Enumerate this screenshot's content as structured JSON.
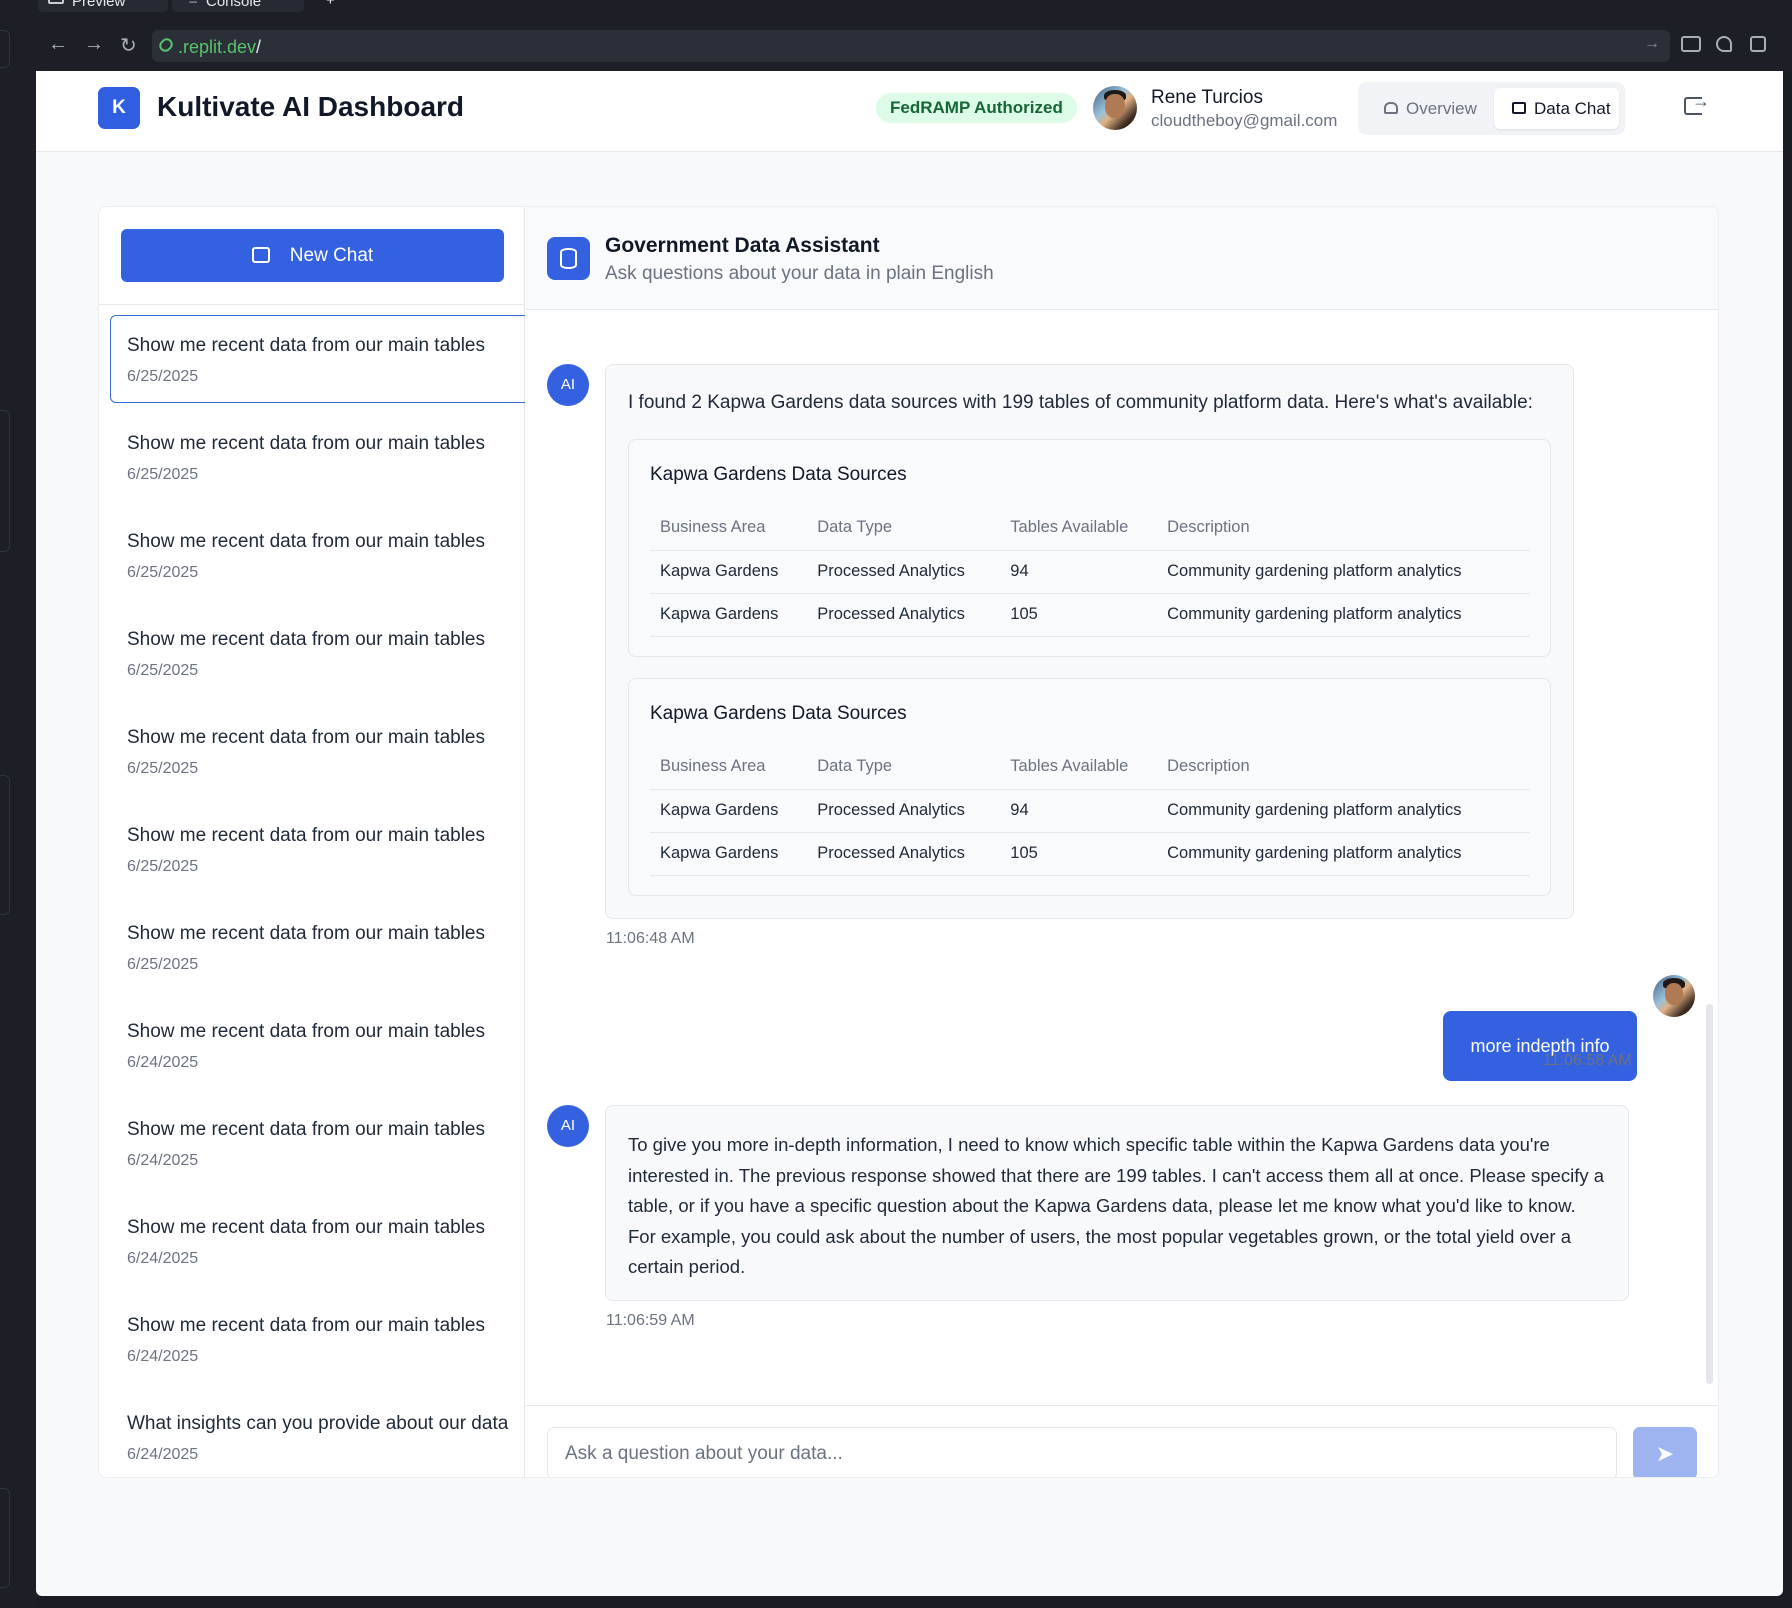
{
  "ide": {
    "tabs": [
      {
        "label": "Preview"
      },
      {
        "label": "Console"
      }
    ],
    "new_tab": "+",
    "url_host": ".replit.dev",
    "url_path": "/"
  },
  "header": {
    "logo_letter": "K",
    "title": "Kultivate AI Dashboard",
    "badge": "FedRAMP Authorized",
    "user_name": "Rene Turcios",
    "user_email": "cloudtheboy@gmail.com",
    "nav": [
      {
        "label": "Overview",
        "active": false
      },
      {
        "label": "Data Chat",
        "active": true
      }
    ]
  },
  "sidebar": {
    "new_chat_label": "New Chat",
    "history": [
      {
        "title": "Show me recent data from our main tables",
        "date": "6/25/2025"
      },
      {
        "title": "Show me recent data from our main tables",
        "date": "6/25/2025"
      },
      {
        "title": "Show me recent data from our main tables",
        "date": "6/25/2025"
      },
      {
        "title": "Show me recent data from our main tables",
        "date": "6/25/2025"
      },
      {
        "title": "Show me recent data from our main tables",
        "date": "6/25/2025"
      },
      {
        "title": "Show me recent data from our main tables",
        "date": "6/25/2025"
      },
      {
        "title": "Show me recent data from our main tables",
        "date": "6/25/2025"
      },
      {
        "title": "Show me recent data from our main tables",
        "date": "6/24/2025"
      },
      {
        "title": "Show me recent data from our main tables",
        "date": "6/24/2025"
      },
      {
        "title": "Show me recent data from our main tables",
        "date": "6/24/2025"
      },
      {
        "title": "Show me recent data from our main tables",
        "date": "6/24/2025"
      },
      {
        "title": "What insights can you provide about our data",
        "date": "6/24/2025"
      }
    ]
  },
  "chat": {
    "title": "Government Data Assistant",
    "subtitle": "Ask questions about your data in plain English",
    "ai_label": "AI",
    "messages": [
      {
        "text": "I found 2 Kapwa Gardens data sources with 199 tables of community platform data. Here's what's available:",
        "time": "11:06:48 AM",
        "tables": [
          {
            "title": "Kapwa Gardens Data Sources",
            "headers": [
              "Business Area",
              "Data Type",
              "Tables Available",
              "Description"
            ],
            "rows": [
              [
                "Kapwa Gardens",
                "Processed Analytics",
                "94",
                "Community gardening platform analytics"
              ],
              [
                "Kapwa Gardens",
                "Processed Analytics",
                "105",
                "Community gardening platform analytics"
              ]
            ]
          },
          {
            "title": "Kapwa Gardens Data Sources",
            "headers": [
              "Business Area",
              "Data Type",
              "Tables Available",
              "Description"
            ],
            "rows": [
              [
                "Kapwa Gardens",
                "Processed Analytics",
                "94",
                "Community gardening platform analytics"
              ],
              [
                "Kapwa Gardens",
                "Processed Analytics",
                "105",
                "Community gardening platform analytics"
              ]
            ]
          }
        ]
      },
      {
        "text": "more indepth info",
        "time": "11:06:58 AM"
      },
      {
        "text": "To give you more in-depth information, I need to know which specific table within the Kapwa Gardens data you're interested in.  The previous response showed that there are 199 tables.  I can't access them all at once.  Please specify a table, or if you have a specific question about the Kapwa Gardens data, please let me know what you'd like to know.  For example, you could ask about the number of users, the most popular vegetables grown, or the total yield over a certain period.",
        "time": "11:06:59 AM"
      }
    ],
    "input_placeholder": "Ask a question about your data..."
  },
  "colors": {
    "accent": "#3461df",
    "badge_bg": "#dcfce7",
    "badge_text": "#166534"
  },
  "icons": [
    "monitor-icon",
    "terminal-icon",
    "close-icon",
    "back-icon",
    "forward-icon",
    "reload-icon",
    "link-icon",
    "home-icon",
    "chat-bubble-icon",
    "logout-icon",
    "database-icon",
    "send-icon"
  ]
}
